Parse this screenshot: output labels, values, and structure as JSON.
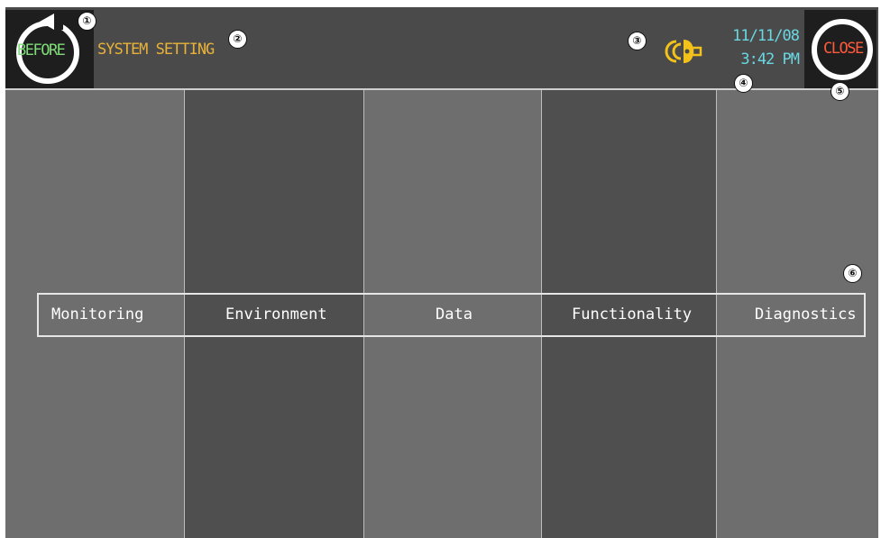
{
  "header": {
    "back_button_label": "BEFORE",
    "title": "SYSTEM SETTING",
    "alarm_icon": "alarm-bell-icon",
    "date": "11/11/08",
    "time": "3:42 PM",
    "close_button_label": "CLOSE"
  },
  "callouts": [
    "①",
    "②",
    "③",
    "④",
    "⑤",
    "⑥"
  ],
  "menu": {
    "items": [
      {
        "label": "Monitoring"
      },
      {
        "label": "Environment"
      },
      {
        "label": "Data"
      },
      {
        "label": "Functionality"
      },
      {
        "label": "Diagnostics"
      }
    ]
  },
  "colors": {
    "back_label": "#7fdc78",
    "title": "#e8b23a",
    "clock": "#6ad7e3",
    "close_label": "#ff5a3c",
    "alarm_icon": "#f2c21a"
  }
}
